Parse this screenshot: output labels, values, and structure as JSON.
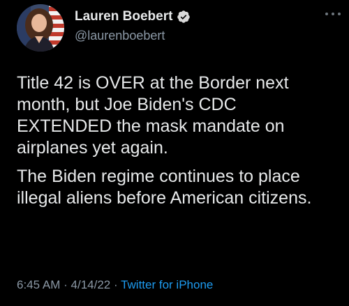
{
  "author": {
    "display_name": "Lauren Boebert",
    "handle": "@laurenboebert",
    "verified_icon": "verified-badge-icon",
    "avatar_icon": "profile-photo"
  },
  "tweet": {
    "paragraphs": [
      "Title 42 is OVER at the Border next month, but Joe Biden's CDC EXTENDED the mask mandate on airplanes yet again.",
      "The Biden regime continues to place illegal aliens before American citizens."
    ]
  },
  "meta": {
    "time": "6:45 AM",
    "separator": "·",
    "date": "4/14/22",
    "source": "Twitter for iPhone"
  },
  "colors": {
    "background": "#000000",
    "text_primary": "#e7e9ea",
    "text_secondary": "#8b98a5",
    "link": "#1d9bf0",
    "verified": "#d9d9d9"
  }
}
